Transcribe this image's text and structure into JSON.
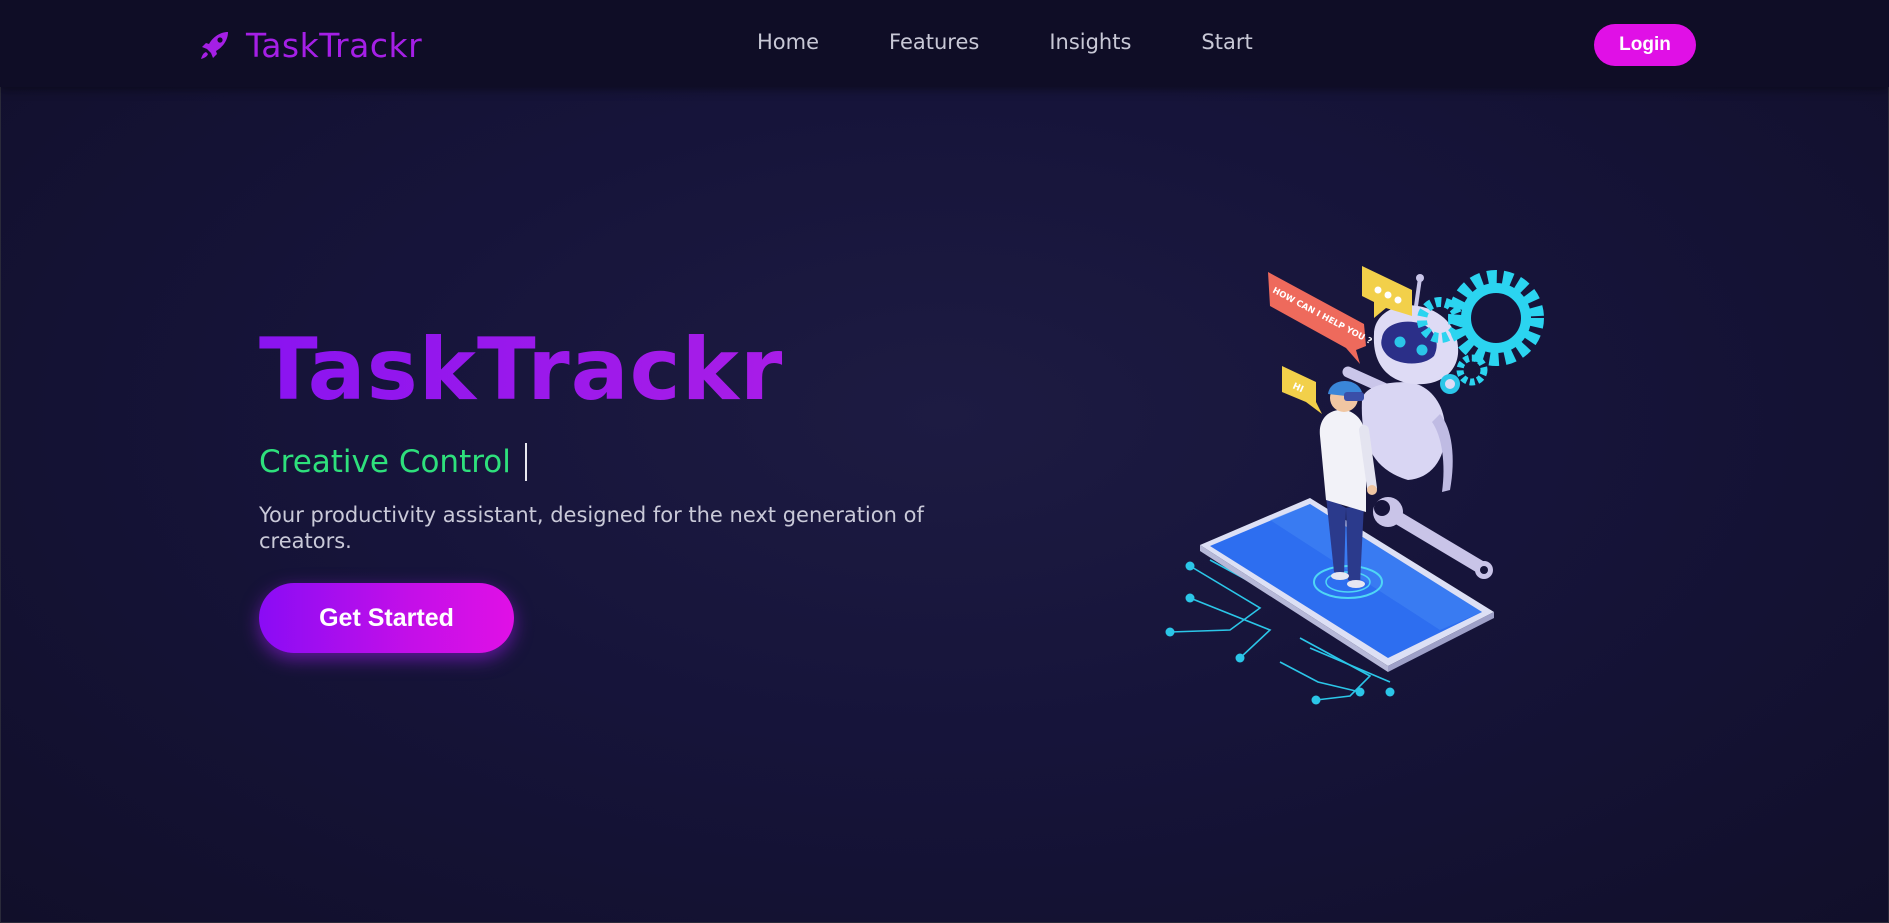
{
  "brand": {
    "name": "TaskTrackr",
    "icon": "rocket-icon"
  },
  "nav": {
    "items": [
      "Home",
      "Features",
      "Insights",
      "Start"
    ]
  },
  "header": {
    "login_label": "Login"
  },
  "hero": {
    "title": "TaskTrackr",
    "tagline": "Creative Control",
    "description": "Your productivity assistant, designed for the next generation of creators.",
    "cta_label": "Get Started"
  },
  "illustration": {
    "bubble_help": "HOW CAN I HELP YOU ?",
    "bubble_hi": "HI"
  },
  "colors": {
    "background": "#14122e",
    "header": "#0f0d26",
    "accent_purple": "#a51fe6",
    "accent_magenta": "#e010e6",
    "accent_green": "#2ee07c"
  }
}
